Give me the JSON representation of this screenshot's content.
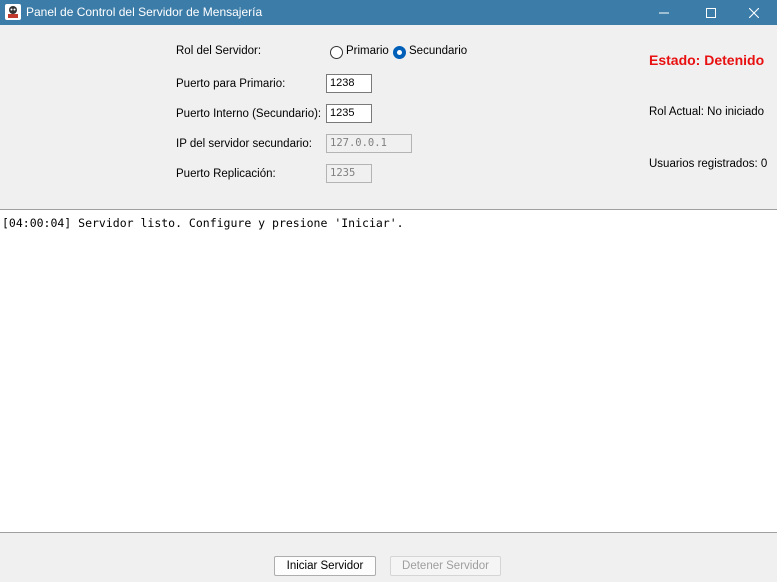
{
  "window": {
    "title": "Panel de Control del Servidor de Mensajería",
    "icon": "app-icon",
    "controls": [
      "minimize-icon",
      "maximize-icon",
      "close-icon"
    ]
  },
  "form": {
    "role_label": "Rol del Servidor:",
    "role_options": [
      {
        "label": "Primario",
        "selected": false
      },
      {
        "label": "Secundario",
        "selected": true
      }
    ],
    "primary_port_label": "Puerto para Primario:",
    "primary_port_value": "1238",
    "internal_port_label": "Puerto Interno (Secundario):",
    "internal_port_value": "1235",
    "secondary_ip_label": "IP del servidor secundario:",
    "secondary_ip_value": "127.0.0.1",
    "replication_port_label": "Puerto Replicación:",
    "replication_port_value": "1235"
  },
  "status": {
    "state": "Estado: Detenido",
    "state_color": "#e81010",
    "current_role": "Rol Actual: No iniciado",
    "registered_users": "Usuarios registrados: 0"
  },
  "log": {
    "lines": [
      "[04:00:04] Servidor listo. Configure y presione 'Iniciar'."
    ]
  },
  "buttons": {
    "start": "Iniciar Servidor",
    "stop": "Detener Servidor"
  },
  "colors": {
    "titlebar": "#3c7ca8",
    "accent": "#005fb8"
  }
}
